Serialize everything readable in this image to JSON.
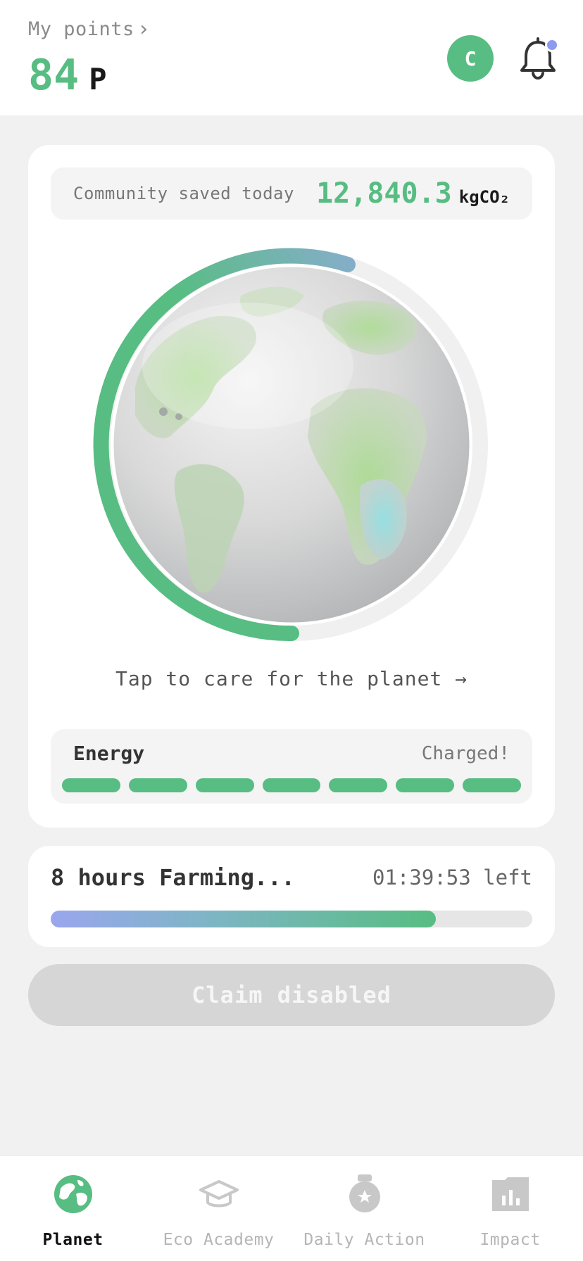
{
  "header": {
    "points_label": "My points",
    "points_value": "84",
    "points_unit": "P",
    "avatar_initial": "C",
    "notification_dot": true
  },
  "community": {
    "label": "Community saved today",
    "value": "12,840.3",
    "unit": "kgCO₂"
  },
  "globe": {
    "progress_fraction": 0.55,
    "care_text": "Tap to care for the planet →"
  },
  "energy": {
    "label": "Energy",
    "status": "Charged!",
    "segments_total": 7,
    "segments_filled": 7
  },
  "farming": {
    "title": "8 hours Farming...",
    "time_left": "01:39:53 left",
    "progress_fraction": 0.8
  },
  "claim": {
    "label": "Claim disabled"
  },
  "nav": {
    "items": [
      {
        "label": "Planet",
        "icon": "planet-icon",
        "active": true
      },
      {
        "label": "Eco Academy",
        "icon": "graduation-cap-icon",
        "active": false
      },
      {
        "label": "Daily Action",
        "icon": "medal-icon",
        "active": false
      },
      {
        "label": "Impact",
        "icon": "bar-chart-icon",
        "active": false
      }
    ]
  },
  "colors": {
    "accent_green": "#57bd82",
    "accent_blue": "#8c9af0",
    "disabled_gray": "#d6d6d6"
  }
}
